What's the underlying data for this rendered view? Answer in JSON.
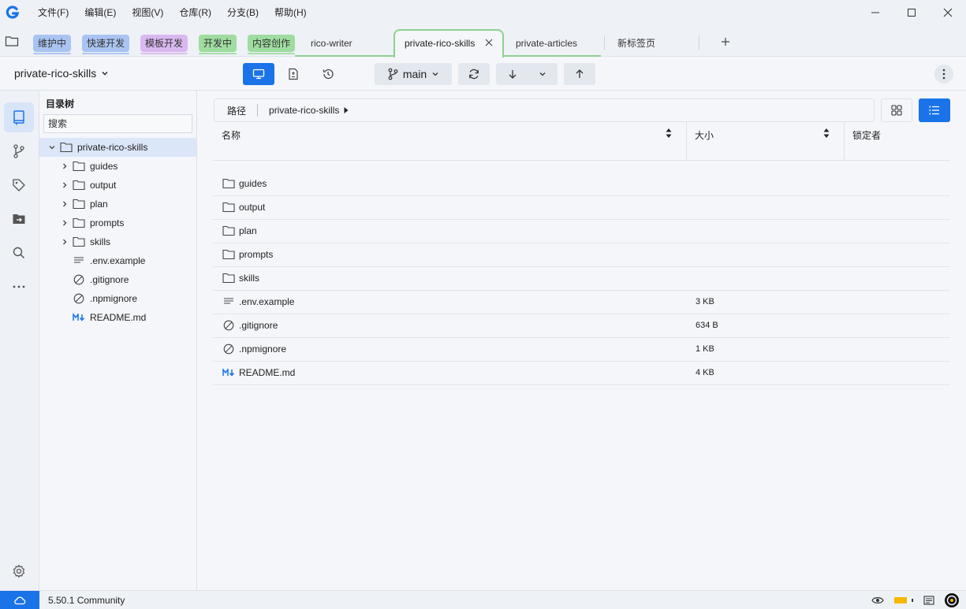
{
  "app": {
    "logo_letter": "G",
    "accent": "#1a73e8"
  },
  "menu": [
    "文件(F)",
    "编辑(E)",
    "视图(V)",
    "仓库(R)",
    "分支(B)",
    "帮助(H)"
  ],
  "tabs": {
    "chips": [
      {
        "label": "维护中",
        "color": "#a9c4f2"
      },
      {
        "label": "快速开发",
        "color": "#a9c4f2"
      },
      {
        "label": "模板开发",
        "color": "#d9b8f0"
      },
      {
        "label": "开发中",
        "color": "#9fdc9f"
      },
      {
        "label": "内容创作",
        "color": "#9fdc9f"
      }
    ],
    "rico_writer": "rico-writer",
    "active": "private-rico-skills",
    "private_articles": "private-articles",
    "new_tab": "新标签页"
  },
  "toolbar": {
    "repo": "private-rico-skills",
    "branch": "main"
  },
  "tree": {
    "title": "目录树",
    "search_placeholder": "搜索",
    "root": "private-rico-skills",
    "folders": [
      "guides",
      "output",
      "plan",
      "prompts",
      "skills"
    ],
    "files": [
      {
        "name": ".env.example",
        "icon": "text-file-icon"
      },
      {
        "name": ".gitignore",
        "icon": "ignore-icon"
      },
      {
        "name": ".npmignore",
        "icon": "ignore-icon"
      },
      {
        "name": "README.md",
        "icon": "markdown-icon"
      }
    ]
  },
  "path": {
    "label": "路径",
    "segment": "private-rico-skills"
  },
  "table": {
    "columns": {
      "name": "名称",
      "size": "大小",
      "locker": "锁定者"
    },
    "rows": [
      {
        "name": "guides",
        "size": "",
        "icon": "folder-icon"
      },
      {
        "name": "output",
        "size": "",
        "icon": "folder-icon"
      },
      {
        "name": "plan",
        "size": "",
        "icon": "folder-icon"
      },
      {
        "name": "prompts",
        "size": "",
        "icon": "folder-icon"
      },
      {
        "name": "skills",
        "size": "",
        "icon": "folder-icon"
      },
      {
        "name": ".env.example",
        "size": "3 KB",
        "icon": "text-file-icon"
      },
      {
        "name": ".gitignore",
        "size": "634 B",
        "icon": "ignore-icon"
      },
      {
        "name": ".npmignore",
        "size": "1 KB",
        "icon": "ignore-icon"
      },
      {
        "name": "README.md",
        "size": "4 KB",
        "icon": "markdown-icon"
      }
    ]
  },
  "status": {
    "version": "5.50.1 Community"
  }
}
